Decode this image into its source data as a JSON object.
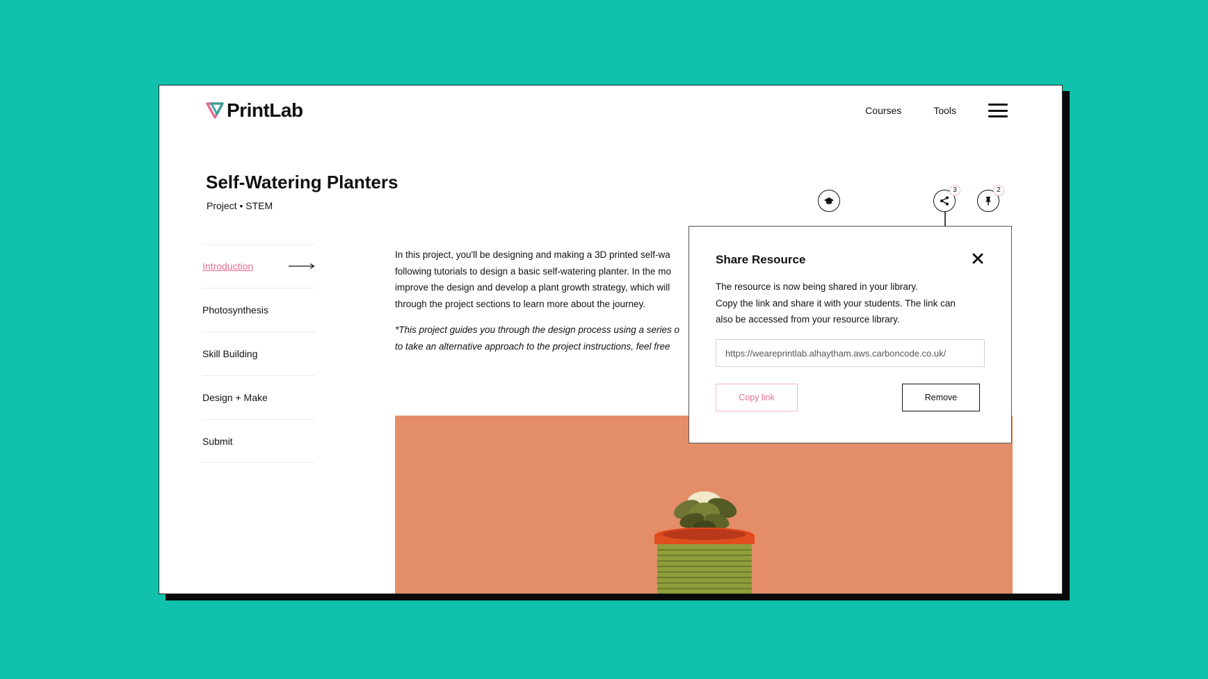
{
  "colors": {
    "background": "#10c1ab",
    "accent_pink": "#e46e92",
    "hero_bg": "#e38e68",
    "text": "#111111"
  },
  "header": {
    "logo_text": "PrintLab",
    "logo_icon": "printlab-triangle-logo",
    "nav": [
      "Courses",
      "Tools"
    ],
    "menu_icon": "hamburger-menu-icon"
  },
  "page": {
    "title": "Self-Watering Planters",
    "subtitle": "Project • STEM"
  },
  "actions": {
    "course_icon": "graduation-cap-icon",
    "share_icon": "share-icon",
    "share_count": "3",
    "pin_icon": "pin-icon",
    "pin_count": "2"
  },
  "sidebar": {
    "items": [
      {
        "label": "Introduction",
        "active": true
      },
      {
        "label": "Photosynthesis"
      },
      {
        "label": "Skill Building"
      },
      {
        "label": "Design + Make"
      },
      {
        "label": "Submit"
      }
    ]
  },
  "content": {
    "lines": [
      "In this project, you'll be designing and making a 3D printed self-wa",
      "following tutorials to design a basic self-watering planter. In the mo",
      "improve the design and develop a plant growth strategy, which will",
      "through the project sections to learn more about the journey."
    ],
    "note_lines": [
      "*This project guides you through the design process using a series o",
      "to take an alternative approach to the project instructions, feel free"
    ]
  },
  "modal": {
    "title": "Share Resource",
    "line1": "The resource is now being shared in your library.",
    "line2": "Copy the link and share it with your students. The link can",
    "line3": "also be accessed from your resource library.",
    "url_value": "https://weareprintlab.alhaytham.aws.carboncode.co.uk/",
    "copy_label": "Copy link",
    "remove_label": "Remove"
  }
}
